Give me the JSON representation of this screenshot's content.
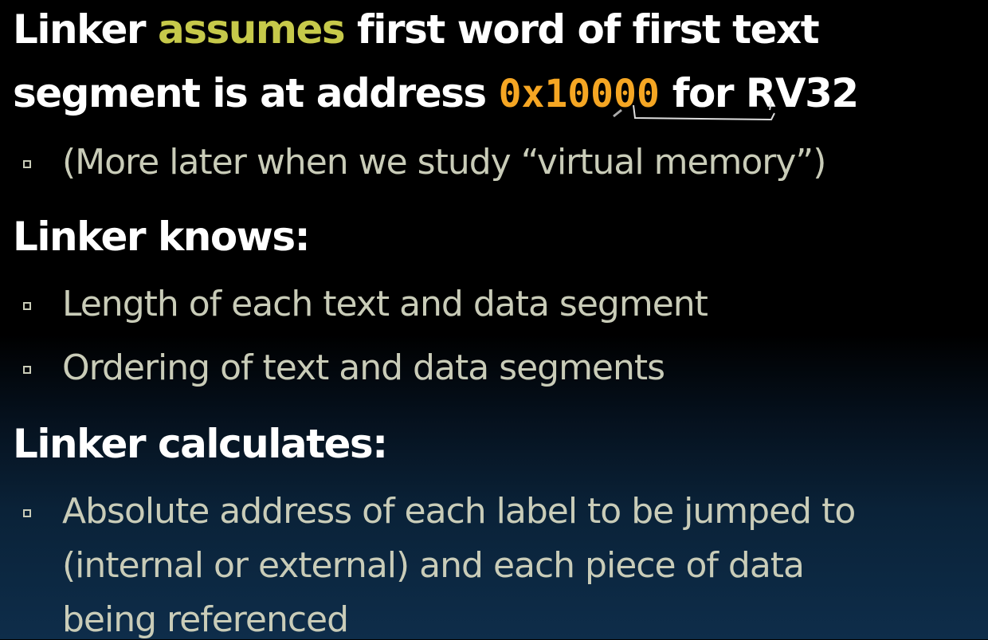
{
  "lines": {
    "l1_a": "Linker ",
    "l1_hl": "assumes",
    "l1_b": " first word of first text",
    "l2_a": "segment is at address ",
    "l2_code": "0x10000",
    "l2_b": " for RV32",
    "b1": "(More later when we study “virtual memory”)",
    "h2": "Linker knows:",
    "b2": "Length of each text and data segment",
    "b3": "Ordering of text and data segments",
    "h3": "Linker calculates:",
    "b4_1": "Absolute address of each label to be jumped to",
    "b4_2": "(internal or external) and each piece of data",
    "b4_3": "being referenced"
  },
  "colors": {
    "heading": "#ffffff",
    "highlight": "#c6c94a",
    "code": "#f5a623",
    "body": "#c9ccb8",
    "caption": "#f0d000"
  }
}
